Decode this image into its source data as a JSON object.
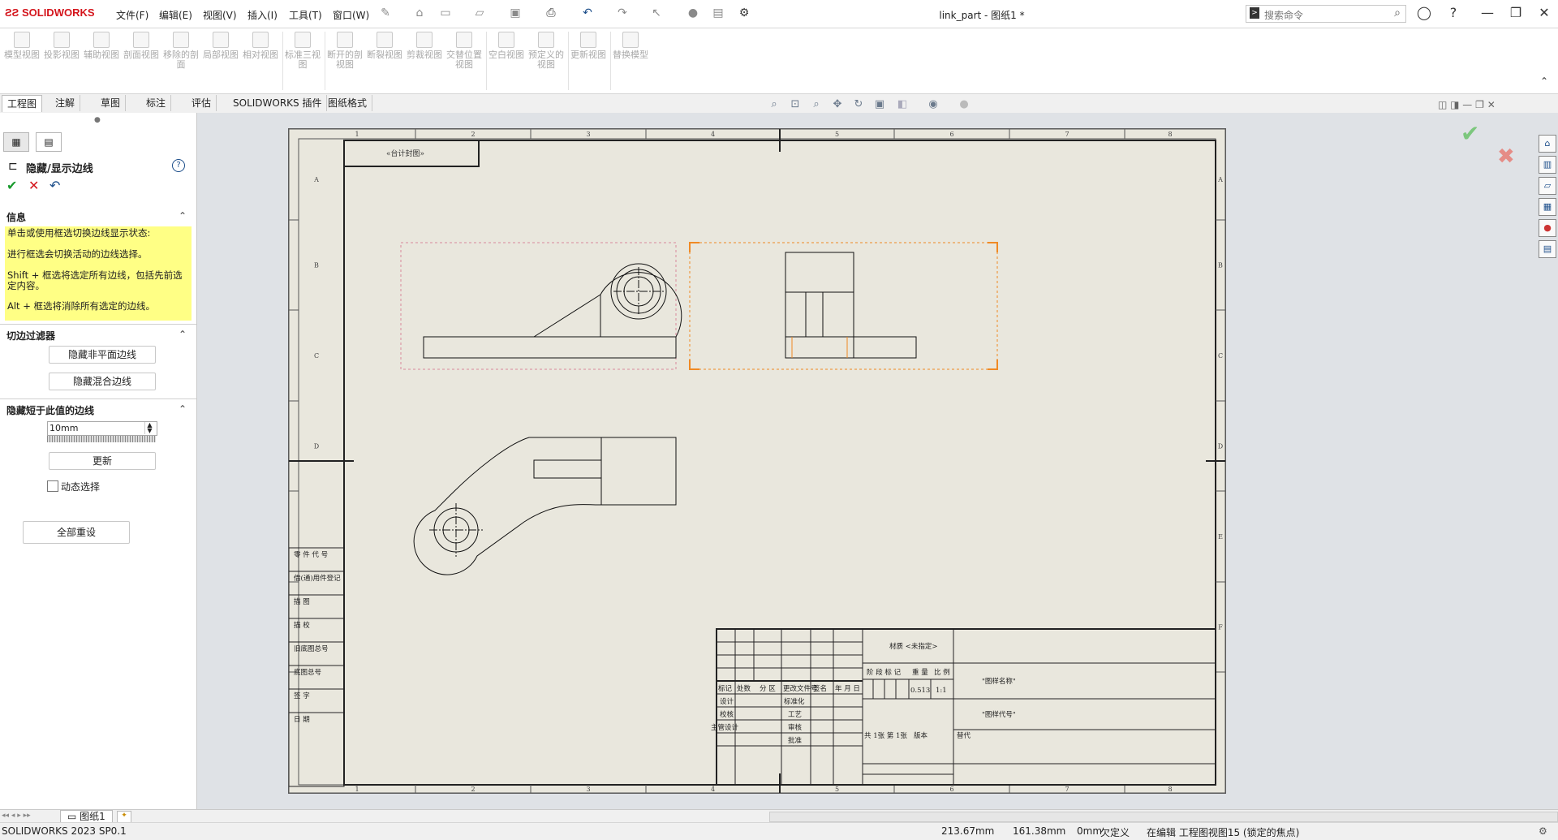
{
  "app": {
    "brand": "SOLIDWORKS",
    "window_title": "link_part - 图纸1 *"
  },
  "menu": [
    "文件(F)",
    "编辑(E)",
    "视图(V)",
    "插入(I)",
    "工具(T)",
    "窗口(W)"
  ],
  "search": {
    "placeholder": "搜索命令"
  },
  "ribbon": [
    {
      "label": "模型视图"
    },
    {
      "label": "投影视图"
    },
    {
      "label": "辅助视图"
    },
    {
      "label": "剖面视图"
    },
    {
      "label": "移除的剖面"
    },
    {
      "label": "局部视图"
    },
    {
      "label": "相对视图"
    },
    {
      "label": "标准三视图"
    },
    {
      "label": "断开的剖视图"
    },
    {
      "label": "断裂视图"
    },
    {
      "label": "剪裁视图"
    },
    {
      "label": "交替位置视图"
    },
    {
      "label": "空白视图"
    },
    {
      "label": "预定义的视图"
    },
    {
      "label": "更新视图"
    },
    {
      "label": "替换模型"
    }
  ],
  "tabs": [
    "工程图",
    "注解",
    "草图",
    "标注",
    "评估",
    "SOLIDWORKS 插件",
    "图纸格式"
  ],
  "panel": {
    "title": "隐藏/显示边线",
    "info_header": "信息",
    "info_lines": [
      "单击或使用框选切换边线显示状态:",
      "进行框选会切换活动的边线选择。",
      "Shift + 框选将选定所有边线，包括先前选定内容。",
      "Alt + 框选将消除所有选定的边线。"
    ],
    "filter_header": "切边过滤器",
    "hide_nonplanar": "隐藏非平面边线",
    "hide_blend": "隐藏混合边线",
    "short_header": "隐藏短于此值的边线",
    "short_value": "10mm",
    "update": "更新",
    "dynamic": "动态选择",
    "reset_all": "全部重设"
  },
  "sheet": {
    "col_labels": [
      "1",
      "2",
      "3",
      "4",
      "5",
      "6",
      "7",
      "8"
    ],
    "row_labels": [
      "A",
      "B",
      "C",
      "D",
      "E",
      "F"
    ],
    "top_left_box": "«台计封图»",
    "left_strip": [
      "零 件 代 号",
      "借(通)用件登记",
      "描 图",
      "描 校",
      "旧底图总号",
      "底图总号",
      "签 字",
      "日 期"
    ],
    "title_block": {
      "material": "材质 <未指定>",
      "drawing_name": "\"图样名称\"",
      "drawing_code": "\"图样代号\"",
      "mark_row": [
        "标记",
        "处数",
        "分 区",
        "更改文件号",
        "签名",
        "年 月 日"
      ],
      "stage_label": "阶 段 标 记",
      "weight_label": "重 量",
      "scale_label": "比 例",
      "weight": "0.513",
      "scale": "1:1",
      "roles": [
        "设计",
        "校核",
        "主管设计"
      ],
      "roles2": [
        "标准化",
        "工艺",
        "审核",
        "批准"
      ],
      "sheet_info": "共 1张  第 1张",
      "version": "版本",
      "replace": "替代"
    }
  },
  "sheet_tab": "图纸1",
  "status": {
    "version": "SOLIDWORKS 2023 SP0.1",
    "x": "213.67mm",
    "y": "161.38mm",
    "z": "0mm",
    "defined": "欠定义",
    "editing": "在编辑 工程图视图15 (锁定的焦点)"
  },
  "colors": {
    "selection": "#f08a24",
    "accent_red": "#d4151c",
    "info_bg": "#ffff85",
    "sheet_bg": "#e9e7dd"
  }
}
